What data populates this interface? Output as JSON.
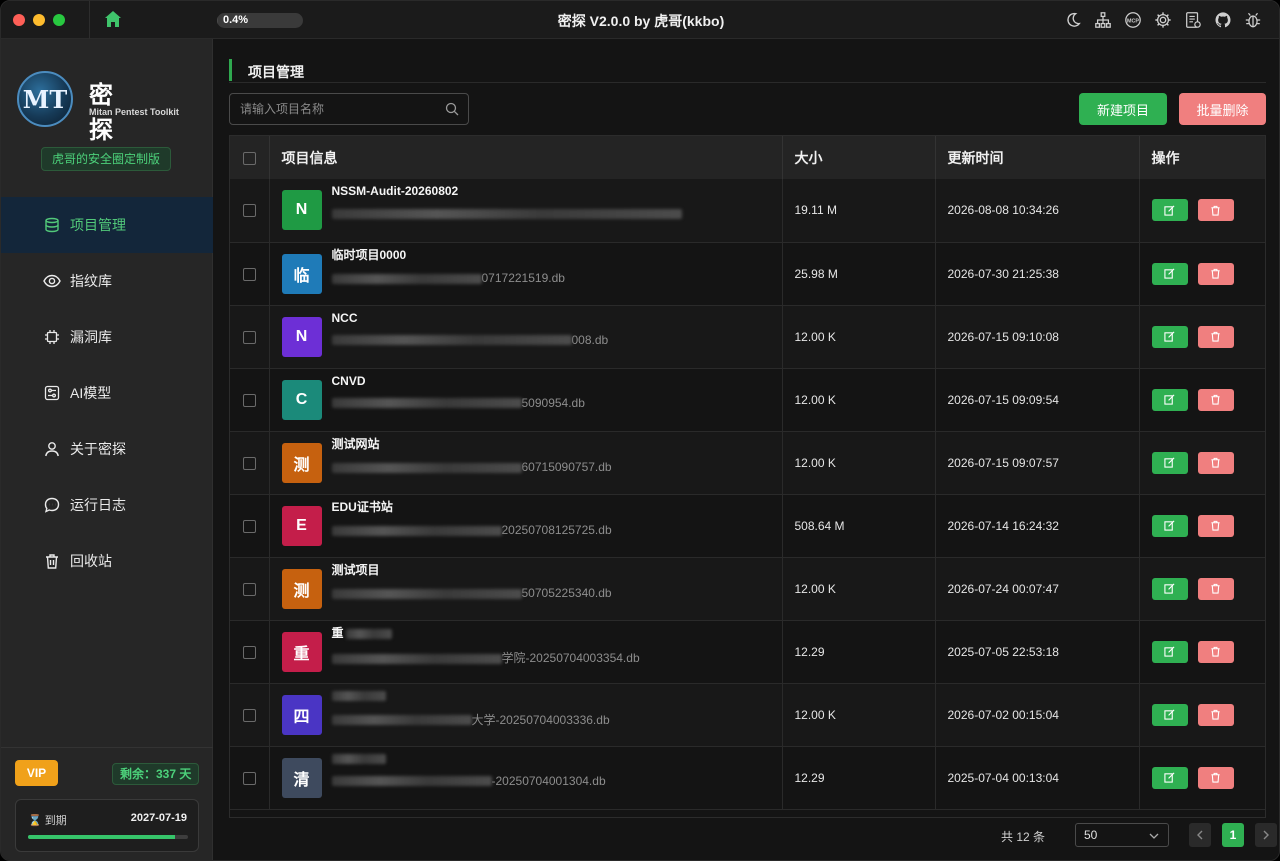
{
  "window": {
    "title": "密探 V2.0.0 by 虎哥(kkbo)",
    "progress_text": "0.4%",
    "progress_value": 0.004
  },
  "toolbar_icons": [
    "moon-icon",
    "sitemap-icon",
    "mcp-icon",
    "gear-icon",
    "log-icon",
    "github-icon",
    "bug-icon"
  ],
  "sidebar": {
    "logo_letters": "MT",
    "logo_name": "密探",
    "logo_subtitle": "Mitan Pentest Toolkit",
    "edition": "虎哥的安全圈定制版",
    "items": [
      {
        "label": "项目管理",
        "icon": "database-icon",
        "active": true
      },
      {
        "label": "指纹库",
        "icon": "eye-icon",
        "active": false
      },
      {
        "label": "漏洞库",
        "icon": "chip-icon",
        "active": false
      },
      {
        "label": "AI模型",
        "icon": "sliders-icon",
        "active": false
      },
      {
        "label": "关于密探",
        "icon": "user-icon",
        "active": false
      },
      {
        "label": "运行日志",
        "icon": "chat-icon",
        "active": false
      },
      {
        "label": "回收站",
        "icon": "trash-icon",
        "active": false
      }
    ],
    "vip_label": "VIP",
    "remaining": "剩余：337 天",
    "expire_label": "到期",
    "expire_date": "2027-07-19",
    "expire_progress": 0.92
  },
  "main": {
    "page_title": "项目管理",
    "search_placeholder": "请输入项目名称",
    "new_button": "新建项目",
    "batch_delete_button": "批量删除",
    "columns": [
      "项目信息",
      "大小",
      "更新时间",
      "操作"
    ],
    "rows": [
      {
        "letter": "N",
        "color": "#1f9a44",
        "name": "NSSM-Audit-20260802",
        "path_suffix": "",
        "size": "19.11 M",
        "updated": "2026-08-08 10:34:26"
      },
      {
        "letter": "临",
        "color": "#1f7bb8",
        "name": "临时项目0000",
        "path_suffix": "0717221519.db",
        "size": "25.98 M",
        "updated": "2026-07-30 21:25:38"
      },
      {
        "letter": "N",
        "color": "#6d2fd6",
        "name": "NCC",
        "path_suffix": "008.db",
        "size": "12.00 K",
        "updated": "2026-07-15 09:10:08"
      },
      {
        "letter": "C",
        "color": "#1b8a7a",
        "name": "CNVD",
        "path_suffix": "5090954.db",
        "size": "12.00 K",
        "updated": "2026-07-15 09:09:54"
      },
      {
        "letter": "测",
        "color": "#c6610f",
        "name": "测试网站",
        "path_suffix": "60715090757.db",
        "size": "12.00 K",
        "updated": "2026-07-15 09:07:57"
      },
      {
        "letter": "E",
        "color": "#c41e4a",
        "name": "EDU证书站",
        "path_suffix": "20250708125725.db",
        "size": "508.64 M",
        "updated": "2026-07-14 16:24:32"
      },
      {
        "letter": "测",
        "color": "#c6610f",
        "name": "测试项目",
        "path_suffix": "50705225340.db",
        "size": "12.00 K",
        "updated": "2026-07-24 00:07:47"
      },
      {
        "letter": "重",
        "color": "#c41e4a",
        "name": "重",
        "path_suffix": "学院-20250704003354.db",
        "size": "12.29",
        "updated": "2025-07-05 22:53:18"
      },
      {
        "letter": "四",
        "color": "#4a35c4",
        "name": "",
        "path_suffix": "大学-20250704003336.db",
        "size": "12.00 K",
        "updated": "2026-07-02 00:15:04"
      },
      {
        "letter": "清",
        "color": "#3e4a5e",
        "name": "",
        "path_suffix": "-20250704001304.db",
        "size": "12.29",
        "updated": "2025-07-04 00:13:04"
      }
    ]
  },
  "footer": {
    "total": "共 12 条",
    "page_size": "50",
    "current_page": "1"
  }
}
